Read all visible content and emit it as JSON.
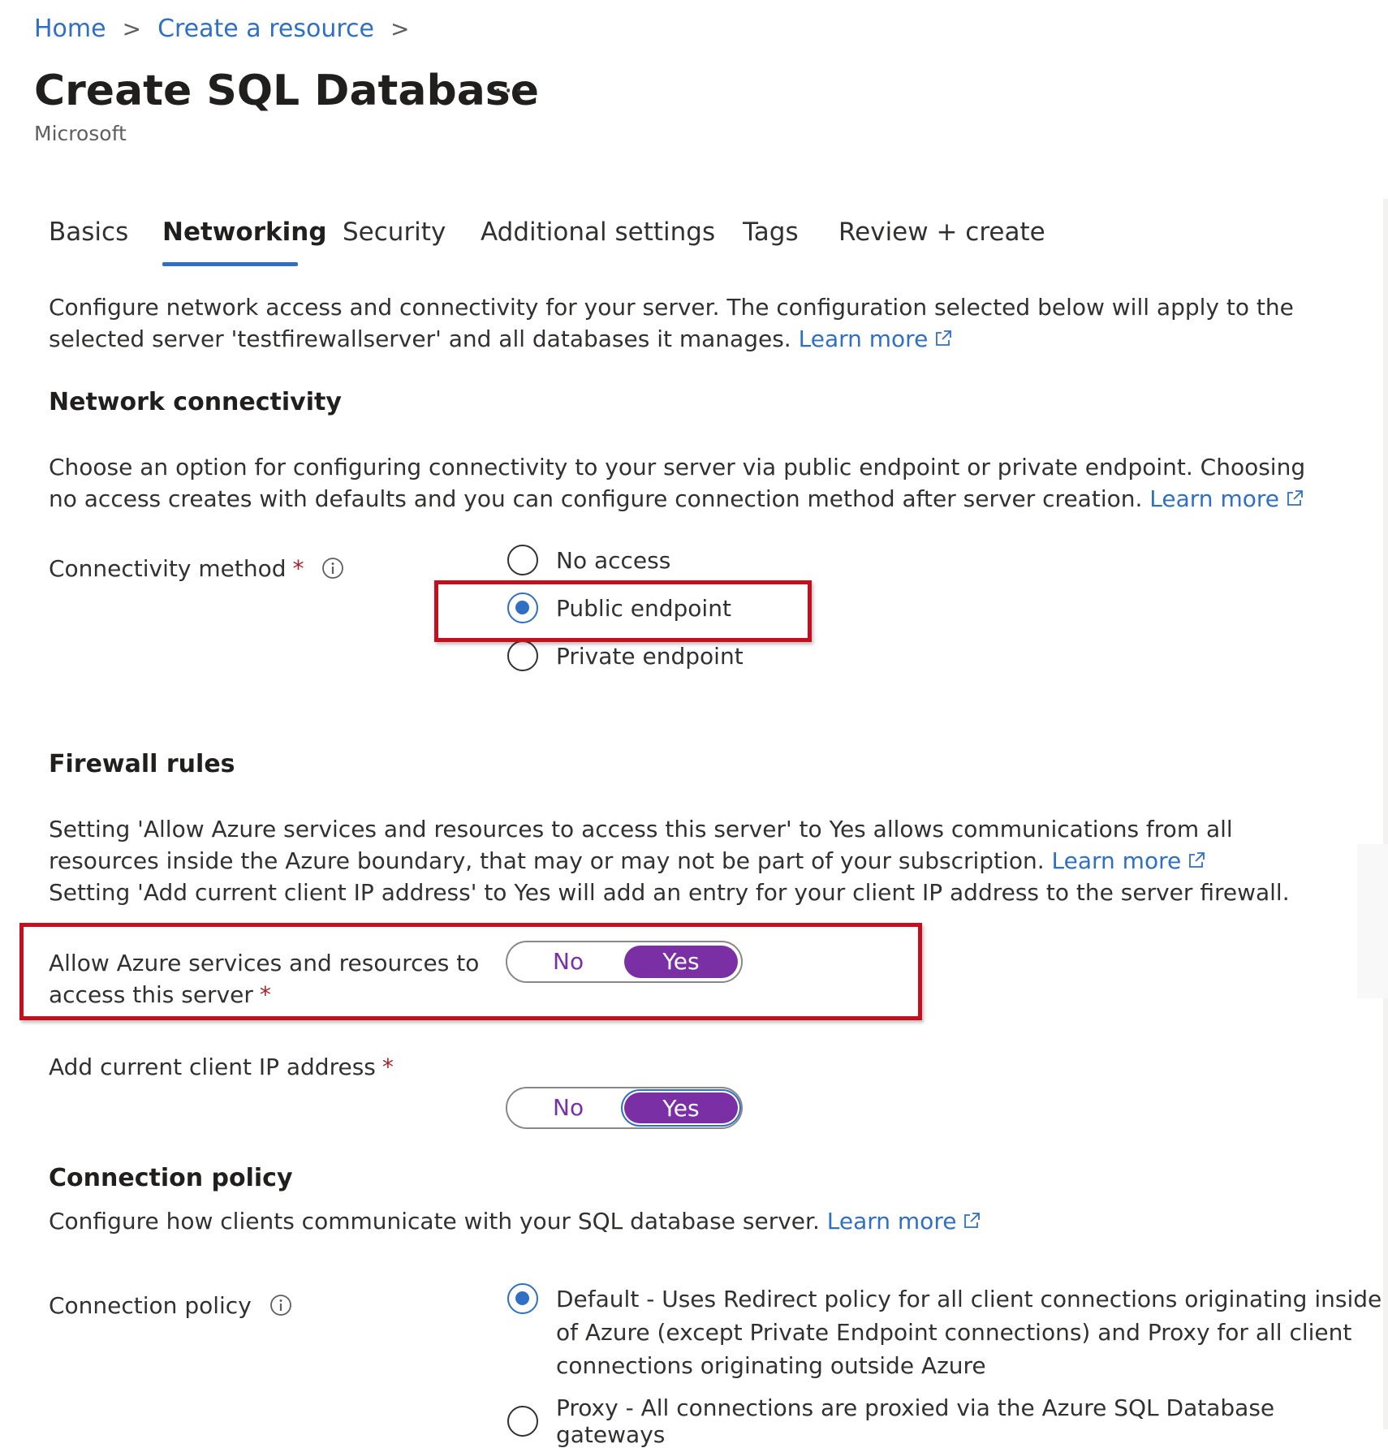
{
  "breadcrumb": {
    "items": [
      "Home",
      "Create a resource"
    ]
  },
  "header": {
    "title": "Create SQL Database",
    "more": "···",
    "subtitle": "Microsoft"
  },
  "tabs": [
    {
      "label": "Basics",
      "active": false
    },
    {
      "label": "Networking",
      "active": true
    },
    {
      "label": "Security",
      "active": false
    },
    {
      "label": "Additional settings",
      "active": false
    },
    {
      "label": "Tags",
      "active": false
    },
    {
      "label": "Review + create",
      "active": false
    }
  ],
  "intro": {
    "text": "Configure network access and connectivity for your server. The configuration selected below will apply to the selected server 'testfirewallserver' and all databases it manages.",
    "link": "Learn more"
  },
  "network_connectivity": {
    "heading": "Network connectivity",
    "description": "Choose an option for configuring connectivity to your server via public endpoint or private endpoint. Choosing no access creates with defaults and you can configure connection method after server creation.",
    "link": "Learn more",
    "field_label": "Connectivity method",
    "required_mark": "*",
    "options": [
      "No access",
      "Public endpoint",
      "Private endpoint"
    ],
    "selected": "Public endpoint"
  },
  "firewall": {
    "heading": "Firewall rules",
    "description_1": "Setting 'Allow Azure services and resources to access this server' to Yes allows communications from all resources inside the Azure boundary, that may or may not be part of your subscription.",
    "link": "Learn more",
    "description_2": "Setting 'Add current client IP address' to Yes will add an entry for your client IP address to the server firewall.",
    "allow_azure": {
      "label_line1": "Allow Azure services and resources to",
      "label_line2": "access this server",
      "required_mark": "*",
      "no": "No",
      "yes": "Yes",
      "value": "Yes"
    },
    "client_ip": {
      "label": "Add current client IP address",
      "required_mark": "*",
      "no": "No",
      "yes": "Yes",
      "value": "Yes"
    }
  },
  "connection_policy": {
    "heading": "Connection policy",
    "description": "Configure how clients communicate with your SQL database server.",
    "link": "Learn more",
    "field_label": "Connection policy",
    "options": [
      {
        "line1": "Default - Uses Redirect policy for all client connections originating inside",
        "line2": "of Azure (except Private Endpoint connections) and Proxy for all client",
        "line3": "connections originating outside Azure"
      },
      {
        "line1": "Proxy - All connections are proxied via the Azure SQL Database gateways"
      }
    ],
    "selected_index": 0
  },
  "colors": {
    "link": "#2f6fc4",
    "toggle_on": "#7b2fa5",
    "highlight_box": "#c50f1f",
    "required": "#a4262c"
  }
}
